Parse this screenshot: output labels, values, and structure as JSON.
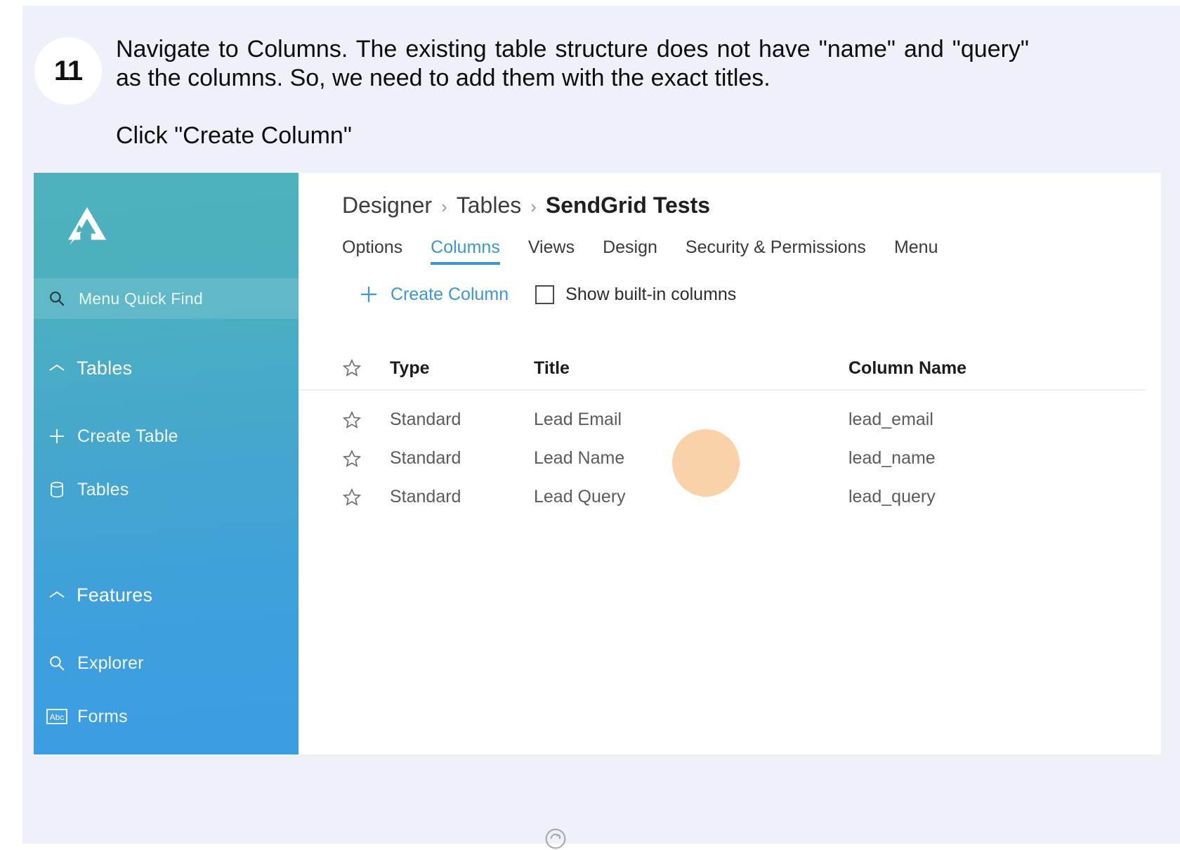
{
  "step": {
    "number": "11",
    "paragraph": "Navigate to Columns. The existing table structure does not have \"name\" and \"query\" as the columns. So, we need to add them with the exact titles.",
    "action": "Click \"Create Column\""
  },
  "colors": {
    "page_background": "#eef1f9",
    "sidebar_top": "#4eb1bd",
    "sidebar_bottom": "#3c9ce3",
    "accent_blue": "#3b97d3",
    "highlight": "#f6a75a"
  },
  "sidebar": {
    "logo_name": "app-logo-icon",
    "quick_find": {
      "icon": "search-icon",
      "label": "Menu Quick Find"
    },
    "groups": [
      {
        "icon": "chevron-up-icon",
        "label": "Tables",
        "items": [
          {
            "icon": "plus-icon",
            "label": "Create Table"
          },
          {
            "icon": "database-icon",
            "label": "Tables"
          }
        ]
      },
      {
        "icon": "chevron-up-icon",
        "label": "Features",
        "items": [
          {
            "icon": "search-icon",
            "label": "Explorer"
          },
          {
            "icon": "abc-box-icon",
            "label": "Forms"
          }
        ]
      }
    ]
  },
  "breadcrumb": {
    "separator": "›",
    "items": [
      "Designer",
      "Tables",
      "SendGrid Tests"
    ]
  },
  "tabs": [
    {
      "label": "Options",
      "active": false
    },
    {
      "label": "Columns",
      "active": true
    },
    {
      "label": "Views",
      "active": false
    },
    {
      "label": "Design",
      "active": false
    },
    {
      "label": "Security & Permissions",
      "active": false
    },
    {
      "label": "Menu",
      "active": false
    }
  ],
  "toolbar": {
    "create_column_label": "Create Column",
    "create_column_icon": "plus-icon",
    "show_builtin_label": "Show built-in columns",
    "show_builtin_checked": false
  },
  "table": {
    "headers": {
      "star": "star-icon",
      "type": "Type",
      "title": "Title",
      "column_name": "Column Name"
    },
    "rows": [
      {
        "star": "star-icon",
        "type": "Standard",
        "title": "Lead Email",
        "column_name": "lead_email"
      },
      {
        "star": "star-icon",
        "type": "Standard",
        "title": "Lead Name",
        "column_name": "lead_name"
      },
      {
        "star": "star-icon",
        "type": "Standard",
        "title": "Lead Query",
        "column_name": "lead_query"
      }
    ]
  },
  "footer": {
    "icon": "reload-icon"
  }
}
